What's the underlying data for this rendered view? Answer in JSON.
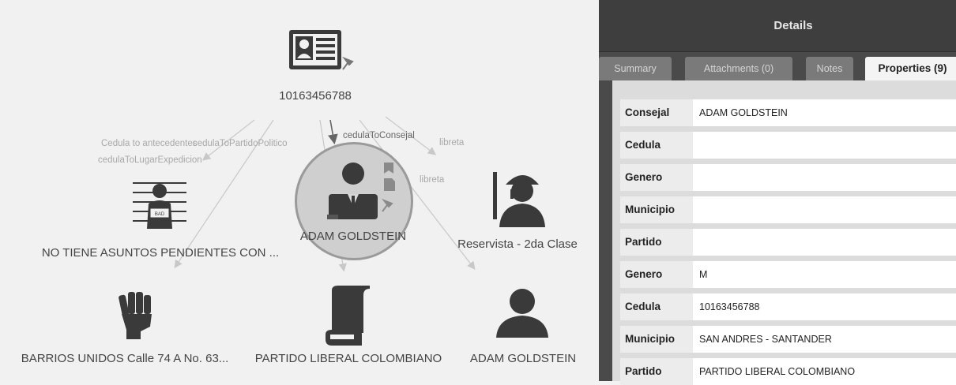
{
  "graph": {
    "nodes": {
      "cedula": {
        "label": "10163456788",
        "icon": "id-card-icon"
      },
      "antecedentes": {
        "label": "NO TIENE ASUNTOS PENDIENTES CON ...",
        "icon": "mugshot-icon"
      },
      "consejal": {
        "label": "ADAM GOLDSTEIN",
        "icon": "politician-icon"
      },
      "libreta": {
        "label": "Reservista - 2da Clase",
        "icon": "soldier-icon"
      },
      "lugar": {
        "label": "BARRIOS UNIDOS Calle 74 A No. 63...",
        "icon": "fist-icon"
      },
      "partido": {
        "label": "PARTIDO LIBERAL COLOMBIANO",
        "icon": "scroll-icon"
      },
      "persona": {
        "label": "ADAM GOLDSTEIN",
        "icon": "person-icon"
      }
    },
    "edge_labels": {
      "antecedentes": "Cedula to antecedentes",
      "partido": "cedulaToPartidoPolitico",
      "lugar": "cedulaToLugarExpedicion",
      "consejal": "cedulaToConsejal",
      "libreta": "libreta",
      "libreta2": "libreta"
    }
  },
  "details": {
    "title": "Details",
    "tabs": [
      "Summary",
      "Attachments (0)",
      "Notes",
      "Properties (9)"
    ],
    "properties": [
      {
        "key": "Consejal",
        "value": "ADAM GOLDSTEIN"
      },
      {
        "key": "Cedula",
        "value": ""
      },
      {
        "key": "Genero",
        "value": ""
      },
      {
        "key": "Municipio",
        "value": ""
      },
      {
        "key": "Partido",
        "value": ""
      },
      {
        "key": "Genero",
        "value": "M"
      },
      {
        "key": "Cedula",
        "value": "10163456788"
      },
      {
        "key": "Municipio",
        "value": "SAN ANDRES - SANTANDER"
      },
      {
        "key": "Partido",
        "value": "PARTIDO LIBERAL COLOMBIANO"
      }
    ]
  },
  "colors": {
    "panel": "#4a4a4a",
    "tab_active": "#f4f4f4",
    "icon": "#3a3a3a"
  }
}
